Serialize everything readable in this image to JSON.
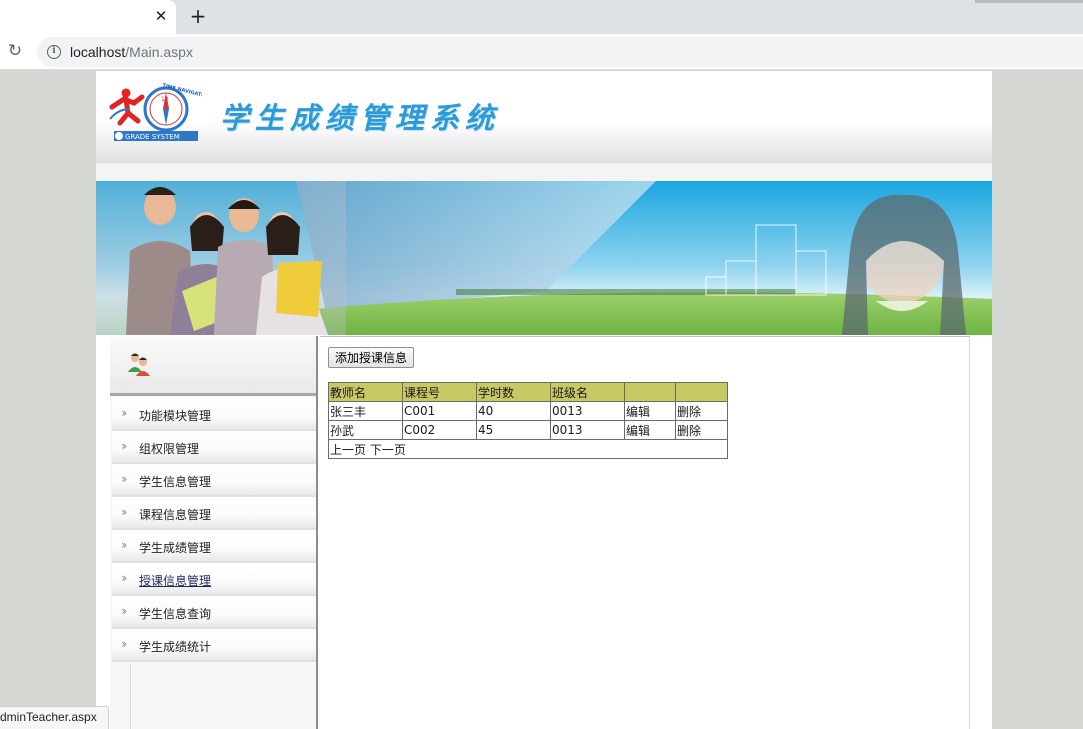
{
  "browser": {
    "url_host": "localhost",
    "url_path": "/Main.aspx",
    "status_text": "dminTeacher.aspx"
  },
  "header": {
    "title": "学生成绩管理系统",
    "logo_top_text": "TIME NAVIGATOR",
    "logo_bottom_text": "GRADE SYSTEM",
    "logo_clock_number": "12"
  },
  "sidebar": {
    "items": [
      {
        "label": "功能模块管理"
      },
      {
        "label": "组权限管理"
      },
      {
        "label": "学生信息管理"
      },
      {
        "label": "课程信息管理"
      },
      {
        "label": "学生成绩管理"
      },
      {
        "label": "授课信息管理",
        "active": true
      },
      {
        "label": "学生信息查询"
      },
      {
        "label": "学生成绩统计"
      }
    ]
  },
  "main": {
    "add_button": "添加授课信息",
    "table": {
      "headers": [
        "教师名",
        "课程号",
        "学时数",
        "班级名",
        "",
        ""
      ],
      "rows": [
        [
          "张三丰",
          "C001",
          "40",
          "0013",
          "编辑",
          "删除"
        ],
        [
          "孙武",
          "C002",
          "45",
          "0013",
          "编辑",
          "删除"
        ]
      ],
      "pager": "上一页 下一页"
    }
  },
  "colors": {
    "title_blue": "#2a9ad8",
    "table_header": "#c8c864",
    "outer_bg": "#d5d8d2"
  }
}
